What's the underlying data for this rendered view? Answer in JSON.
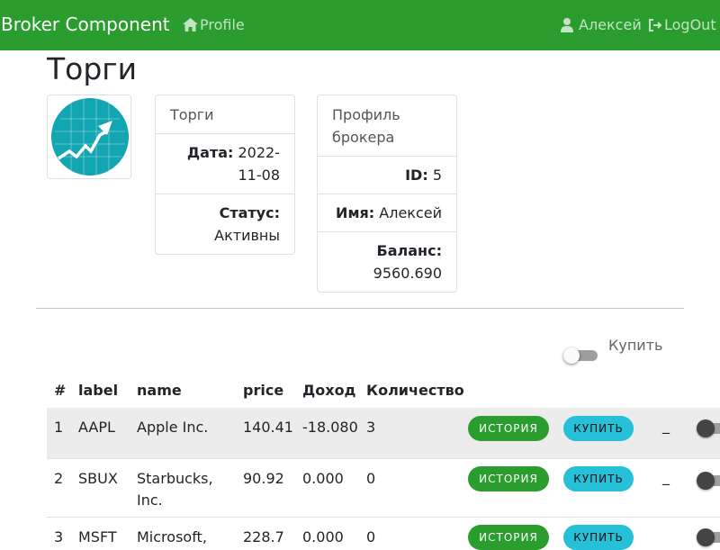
{
  "navbar": {
    "brand": "Broker Component",
    "profile_link": "Profile",
    "user_name": "Алексей",
    "logout": "LogOut",
    "color": "#2a9d2e"
  },
  "page": {
    "title": "Торги"
  },
  "trading_card": {
    "header": "Торги",
    "date_label": "Дата:",
    "date_value": "2022-11-08",
    "status_label": "Статус:",
    "status_value": "Активны"
  },
  "broker_card": {
    "header": "Профиль брокера",
    "id_label": "ID:",
    "id_value": "5",
    "name_label": "Имя:",
    "name_value": "Алексей",
    "balance_label": "Баланс:",
    "balance_value": "9560.690"
  },
  "mode_toggle": {
    "label": "Купить",
    "checked": false
  },
  "table": {
    "headers": [
      "#",
      "label",
      "name",
      "price",
      "Доход",
      "Количество"
    ],
    "rows": [
      {
        "num": "1",
        "label": "AAPL",
        "name": "Apple Inc.",
        "price": "140.41",
        "income": "-18.080",
        "quantity": "3",
        "history": "История",
        "buy": "Купить",
        "dash": "_"
      },
      {
        "num": "2",
        "label": "SBUX",
        "name": "Starbucks, Inc.",
        "price": "90.92",
        "income": "0.000",
        "quantity": "0",
        "history": "История",
        "buy": "Купить",
        "dash": "_"
      },
      {
        "num": "3",
        "label": "MSFT",
        "name": "Microsoft,",
        "price": "228.7",
        "income": "0.000",
        "quantity": "0",
        "history": "История",
        "buy": "Купить",
        "dash": "_"
      }
    ]
  },
  "colors": {
    "history_button": "#2a9d2e",
    "buy_button": "#26c0d9",
    "logo_circle": "#12a5b2"
  }
}
